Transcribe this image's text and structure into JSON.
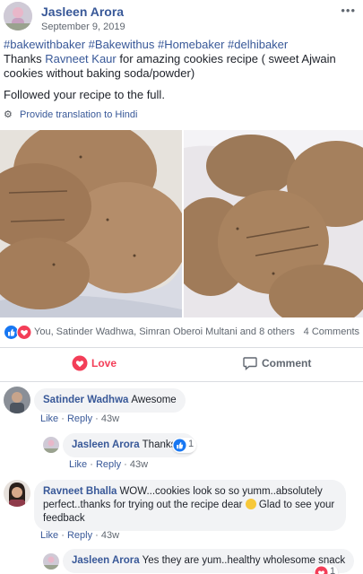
{
  "post": {
    "author": "Jasleen Arora",
    "date": "September 9, 2019",
    "more": "•••",
    "hashtags": "#bakewithbaker #Bakewithus #Homebaker #delhibaker",
    "text_prefix": "Thanks ",
    "mention": "Ravneet Kaur",
    "text_suffix": " for amazing cookies recipe ( sweet Ajwain cookies without baking soda/powder)",
    "text_p2": "Followed your recipe to the full.",
    "translate": "Provide translation to Hindi"
  },
  "reactions": {
    "summary": "You, Satinder Wadhwa, Simran Oberoi Multani and 8 others",
    "comments_count": "4 Comments",
    "icons": [
      "like-icon",
      "love-icon"
    ]
  },
  "actions": {
    "love": "Love",
    "comment": "Comment"
  },
  "comments": [
    {
      "name": "Satinder Wadhwa",
      "text": "Awesome",
      "like": "Like",
      "reply": "Reply",
      "sep": "·",
      "time": "43w"
    },
    {
      "name": "Jasleen Arora",
      "text": "Thanks",
      "like": "Like",
      "reply": "Reply",
      "sep": "·",
      "time": "43w",
      "reaction_count": "1"
    },
    {
      "name": "Ravneet Bhalla",
      "text_a": "WOW...cookies look so so yumm..absolutely perfect..thanks for trying out the recipe dear ",
      "text_b": " Glad to see your feedback",
      "like": "Like",
      "reply": "Reply",
      "sep": "·",
      "time": "43w"
    },
    {
      "name": "Jasleen Arora",
      "text": "Yes they are yum..healthy wholesome snack",
      "reaction_count": "1"
    }
  ],
  "colors": {
    "link": "#385898",
    "love": "#f33e58",
    "like": "#1877f2",
    "bubble": "#f2f3f5"
  }
}
